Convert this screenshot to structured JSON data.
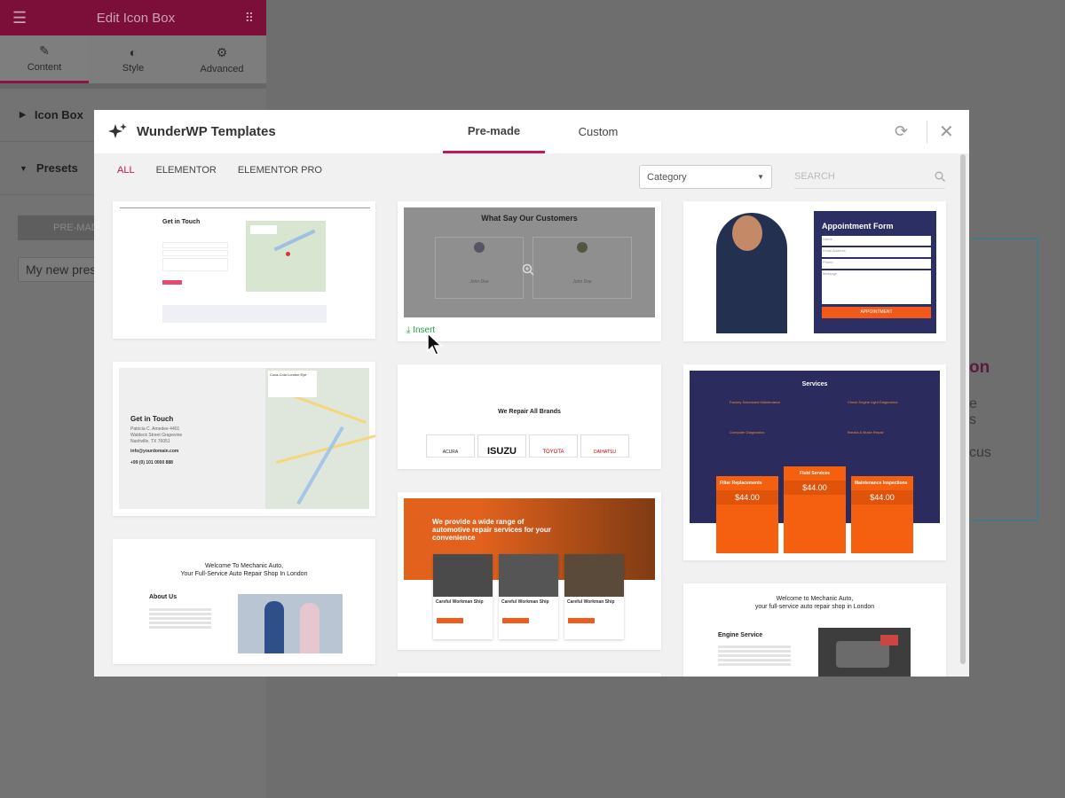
{
  "panel": {
    "title": "Edit Icon Box",
    "tabs": [
      {
        "label": "Content",
        "icon": "pencil-icon"
      },
      {
        "label": "Style",
        "icon": "half-circle-icon"
      },
      {
        "label": "Advanced",
        "icon": "gear-icon"
      }
    ],
    "sections": [
      "Icon Box",
      "Presets"
    ],
    "premade_button": "PRE-MADE",
    "preset_input": "My new pres"
  },
  "background": {
    "fragments": [
      "on",
      "e",
      "s",
      "cus"
    ]
  },
  "modal": {
    "title": "WunderWP Templates",
    "tabs": [
      "Pre-made",
      "Custom"
    ],
    "active_tab": "Pre-made",
    "filters": [
      "ALL",
      "ELEMENTOR",
      "ELEMENTOR PRO"
    ],
    "active_filter": "ALL",
    "category_placeholder": "Category",
    "search_placeholder": "SEARCH",
    "insert_label": "Insert",
    "accent_color": "#c2175b"
  },
  "templates": {
    "contact1": {
      "title": "Get in Touch"
    },
    "contact2": {
      "title": "Get in Touch",
      "address1": "Patricia C. Amedee 4401",
      "address2": "Waldeck Street Grapevine",
      "address3": "Nashville, TX 76051",
      "email": "info@yourdomain.com",
      "phone": "+99 (0) 101 0000 888",
      "map_place": "Coca-Cola London Eye"
    },
    "about": {
      "heading1": "Welcome To Mechanic Auto,",
      "heading2": "Your Full-Service Auto Repair Shop In London",
      "subtitle": "About Us"
    },
    "testimonials": {
      "title": "What Say Our Customers",
      "name1": "John Doe",
      "name2": "John Doe"
    },
    "brands": {
      "title": "We Repair All Brands",
      "logos": [
        "ACURA",
        "ISUZU",
        "TOYOTA",
        "DAIHATSU"
      ]
    },
    "services_range": {
      "title1": "We provide a wide range of",
      "title2": "automotive repair services for your",
      "title3": "convenience",
      "card": "Careful Workman Ship"
    },
    "appointment": {
      "title": "Appointment Form",
      "fields": [
        "Name",
        "Email Address",
        "Phone",
        "Message"
      ],
      "button": "APPOINTMENT"
    },
    "services": {
      "title": "Services",
      "items": [
        "Factory Scheduled Maintenance",
        "Check Engine Light Diagnostics",
        "Computer Diagnostics",
        "Breaks & Brake Repair"
      ],
      "prices": [
        {
          "name": "Filter Replacements",
          "price": "$44.00"
        },
        {
          "name": "Fluid Services",
          "price": "$44.00"
        },
        {
          "name": "Maintenance Inspections",
          "price": "$44.00"
        }
      ]
    },
    "engine": {
      "heading1": "Welcome to Mechanic Auto,",
      "heading2": "your full-service auto repair shop in London",
      "subtitle": "Engine Service"
    }
  }
}
